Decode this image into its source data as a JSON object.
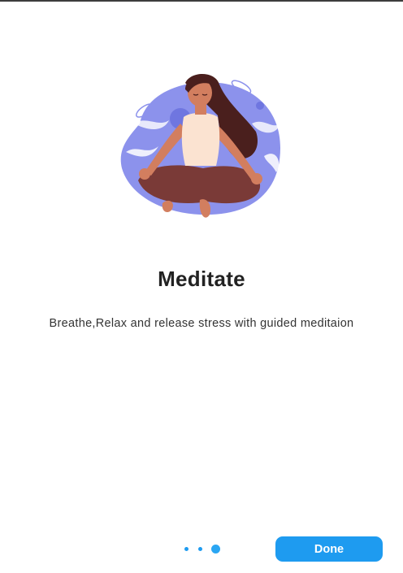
{
  "onboarding": {
    "illustration_name": "woman-meditating-illustration",
    "title": "Meditate",
    "subtitle": "Breathe,Relax and release stress with guided meditaion",
    "page_indicator": {
      "total_pages": 3,
      "current_page": 3
    },
    "done_label": "Done"
  },
  "colors": {
    "accent": "#1e9bf0",
    "blob": "#8c92ec",
    "skin": "#d27e5f",
    "hair": "#4a1f1d",
    "top": "#fbe3d1",
    "pants": "#7a3a37"
  }
}
